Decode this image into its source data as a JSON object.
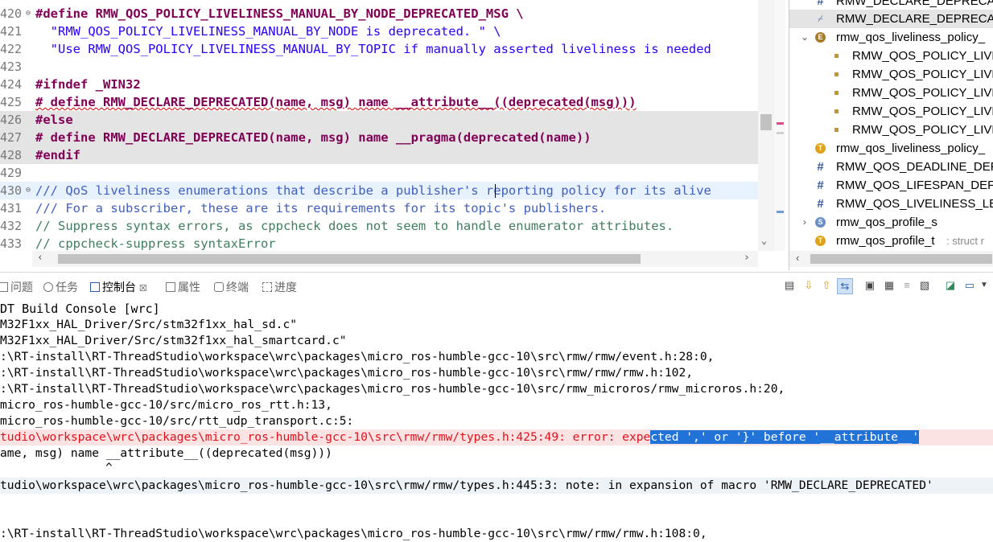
{
  "editor": {
    "lines": [
      {
        "num": "420",
        "text": "#define RMW_QOS_POLICY_LIVELINESS_MANUAL_BY_NODE_DEPRECATED_MSG \\"
      },
      {
        "num": "421",
        "text": "  \"RMW_QOS_POLICY_LIVELINESS_MANUAL_BY_NODE is deprecated. \" \\"
      },
      {
        "num": "422",
        "text": "  \"Use RMW_QOS_POLICY_LIVELINESS_MANUAL_BY_TOPIC if manually asserted liveliness is needed"
      },
      {
        "num": "423",
        "text": ""
      },
      {
        "num": "424",
        "text": "#ifndef _WIN32"
      },
      {
        "num": "425",
        "text": "# define RMW_DECLARE_DEPRECATED(name, msg) name __attribute__((deprecated(msg)))"
      },
      {
        "num": "426",
        "text": "#else"
      },
      {
        "num": "427",
        "text": "# define RMW_DECLARE_DEPRECATED(name, msg) name __pragma(deprecated(name))"
      },
      {
        "num": "428",
        "text": "#endif"
      },
      {
        "num": "429",
        "text": ""
      },
      {
        "num": "430",
        "text": "/// QoS liveliness enumerations that describe a publisher's reporting policy for its alive"
      },
      {
        "num": "431",
        "text": "/// For a subscriber, these are its requirements for its topic's publishers."
      },
      {
        "num": "432",
        "text": "// Suppress syntax errors, as cppcheck does not seem to handle enumerator attributes."
      },
      {
        "num": "433",
        "text": "// cppcheck-suppress syntaxError"
      }
    ]
  },
  "outline": {
    "items": [
      {
        "icon": "#",
        "label": "RMW_DECLARE_DEPRECAT",
        "detail": ""
      },
      {
        "icon": "deprecated",
        "label": "RMW_DECLARE_DEPRECAT",
        "detail": ""
      },
      {
        "icon": "E",
        "label": "rmw_qos_liveliness_policy_",
        "detail": ""
      },
      {
        "icon": "field",
        "label": "RMW_QOS_POLICY_LIVE",
        "detail": ""
      },
      {
        "icon": "field",
        "label": "RMW_QOS_POLICY_LIVE",
        "detail": ""
      },
      {
        "icon": "field",
        "label": "RMW_QOS_POLICY_LIVE",
        "detail": ""
      },
      {
        "icon": "field",
        "label": "RMW_QOS_POLICY_LIVE",
        "detail": ""
      },
      {
        "icon": "field",
        "label": "RMW_QOS_POLICY_LIVE",
        "detail": ""
      },
      {
        "icon": "T",
        "label": "rmw_qos_liveliness_policy_",
        "detail": ""
      },
      {
        "icon": "#",
        "label": "RMW_QOS_DEADLINE_DEFA",
        "detail": ""
      },
      {
        "icon": "#",
        "label": "RMW_QOS_LIFESPAN_DEFA",
        "detail": ""
      },
      {
        "icon": "#",
        "label": "RMW_QOS_LIVELINESS_LEA",
        "detail": ""
      },
      {
        "icon": "S",
        "label": "rmw_qos_profile_s",
        "detail": ""
      },
      {
        "icon": "T",
        "label": "rmw_qos_profile_t",
        "detail": " : struct r"
      }
    ]
  },
  "tabs": [
    {
      "label": "问题",
      "icon": "problems-icon"
    },
    {
      "label": "任务",
      "icon": "tasks-icon"
    },
    {
      "label": "控制台",
      "icon": "console-icon",
      "close": "☒"
    },
    {
      "label": "属性",
      "icon": "properties-icon"
    },
    {
      "label": "终端",
      "icon": "terminal-icon"
    },
    {
      "label": "进度",
      "icon": "progress-icon"
    }
  ],
  "console": {
    "title": "DT Build Console [wrc]",
    "lines": [
      "M32F1xx_HAL_Driver/Src/stm32f1xx_hal_sd.c\"",
      "M32F1xx_HAL_Driver/Src/stm32f1xx_hal_smartcard.c\"",
      ":\\RT-install\\RT-ThreadStudio\\workspace\\wrc\\packages\\micro_ros-humble-gcc-10\\src\\rmw/rmw/event.h:28:0,",
      ":\\RT-install\\RT-ThreadStudio\\workspace\\wrc\\packages\\micro_ros-humble-gcc-10\\src\\rmw/rmw/rmw.h:102,",
      ":\\RT-install\\RT-ThreadStudio\\workspace\\wrc\\packages\\micro_ros-humble-gcc-10\\src/rmw_microros/rmw_microros.h:20,",
      "micro_ros-humble-gcc-10/src/micro_ros_rtt.h:13,",
      "micro_ros-humble-gcc-10/src/rtt_udp_transport.c:5:"
    ],
    "error_pre": "tudio\\workspace\\wrc\\packages\\micro_ros-humble-gcc-10\\src\\rmw/rmw/types.h:425:49: error: expe",
    "error_sel": "cted ',' or '}' before '__attribute__'",
    "line9": "ame, msg) name __attribute__((deprecated(msg)))",
    "caret": "^",
    "note": "tudio\\workspace\\wrc\\packages\\micro_ros-humble-gcc-10\\src\\rmw/rmw/types.h:445:3: note: in expansion of macro 'RMW_DECLARE_DEPRECATED'",
    "last": ":\\RT-install\\RT-ThreadStudio\\workspace\\wrc\\packages\\micro_ros-humble-gcc-10\\src\\rmw/rmw/rmw.h:108:0,"
  }
}
